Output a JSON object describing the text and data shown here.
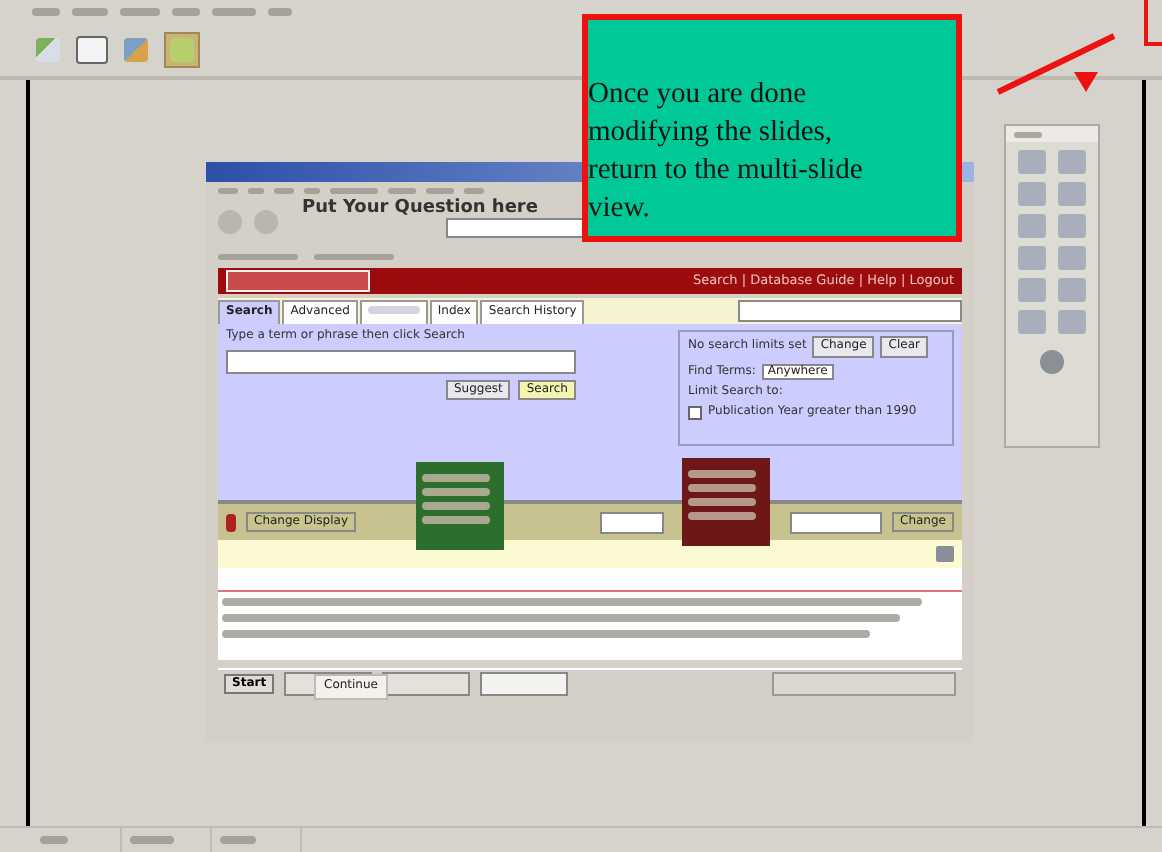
{
  "callout": {
    "text": "Once you are done modifying the slides, return to the multi-slide view."
  },
  "screenshot": {
    "question_overlay": "Put Your Question here",
    "banner_links": "Search | Database Guide | Help | Logout",
    "tabs": [
      {
        "kind": "label",
        "label": "Search",
        "selected": true
      },
      {
        "kind": "label",
        "label": "Advanced",
        "selected": false
      },
      {
        "kind": "blurred",
        "selected": false
      },
      {
        "kind": "label",
        "label": "Index",
        "selected": false
      },
      {
        "kind": "label",
        "label": "Search History",
        "selected": false
      }
    ],
    "search_hint": "Type a term or phrase then click Search",
    "suggest_button": "Suggest",
    "search_button": "Search",
    "limits_text": "No search limits set",
    "change_limits_button": "Change",
    "clear_button": "Clear",
    "find_terms_label": "Find Terms:",
    "find_terms_value": "Anywhere",
    "limit_label": "Limit Search to:",
    "limit_checkbox": {
      "label": "Publication Year greater than 1990",
      "checked": false
    },
    "change_display_button": "Change Display",
    "change_button": "Change",
    "tooltip": "Continue",
    "start_button": "Start"
  }
}
